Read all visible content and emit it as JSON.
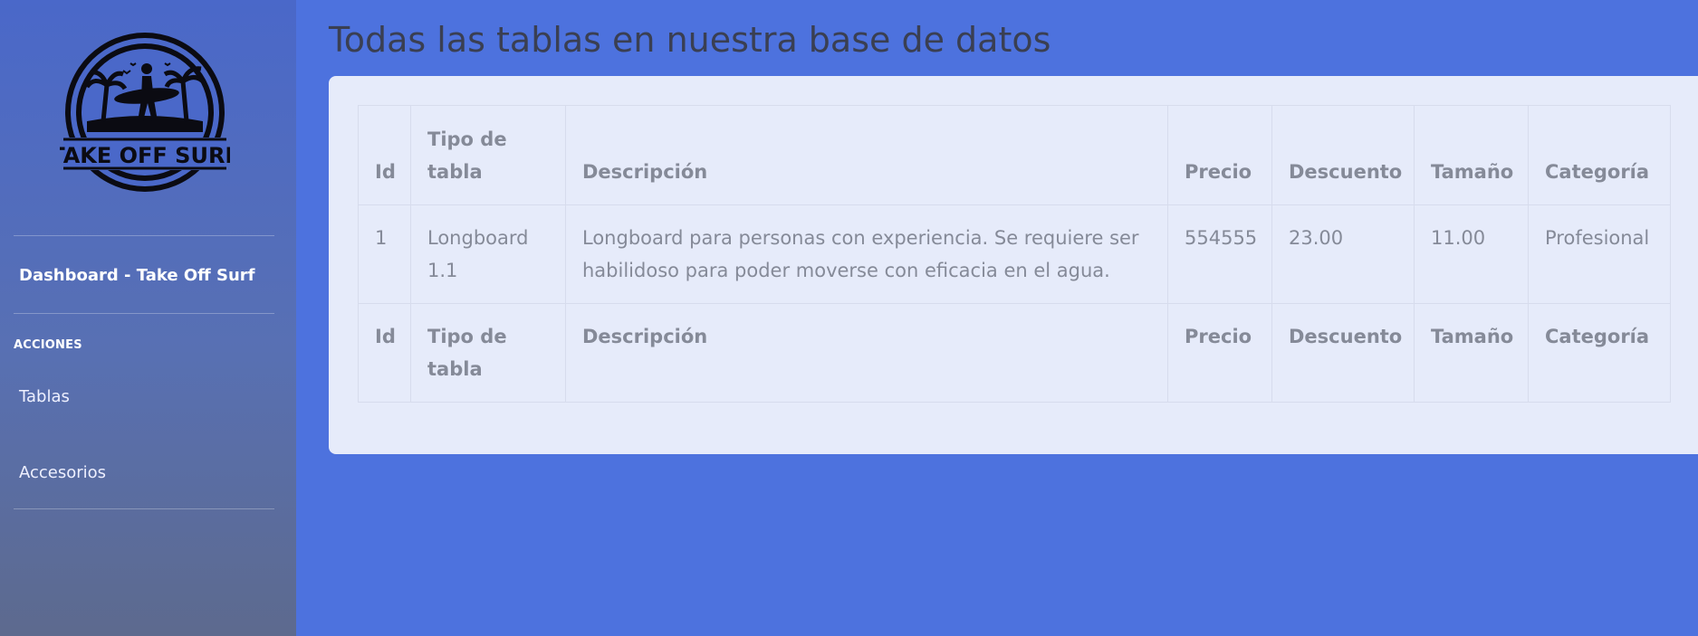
{
  "sidebar": {
    "logo_text": "TAKE OFF SURF",
    "brand": "Dashboard - Take Off Surf",
    "section_heading": "ACCIONES",
    "items": [
      {
        "label": "Tablas"
      },
      {
        "label": "Accesorios"
      }
    ]
  },
  "main": {
    "title": "Todas las tablas en nuestra base de datos",
    "table": {
      "headers": [
        "Id",
        "Tipo de tabla",
        "Descripción",
        "Precio",
        "Descuento",
        "Tamaño",
        "Categoría"
      ],
      "rows": [
        [
          "1",
          "Longboard 1.1",
          "Longboard para personas con experiencia. Se requiere ser habilidoso para poder moverse con eficacia en el agua.",
          "554555",
          "23.00",
          "11.00",
          "Profesional"
        ]
      ],
      "footers": [
        "Id",
        "Tipo de tabla",
        "Descripción",
        "Precio",
        "Descuento",
        "Tamaño",
        "Categoría"
      ]
    }
  },
  "colors": {
    "background": "#4d72de",
    "sidebar_top": "#4a68c9",
    "sidebar_bottom": "#5d6a8e",
    "card": "#e6ebfa",
    "table_text": "#858a98"
  }
}
